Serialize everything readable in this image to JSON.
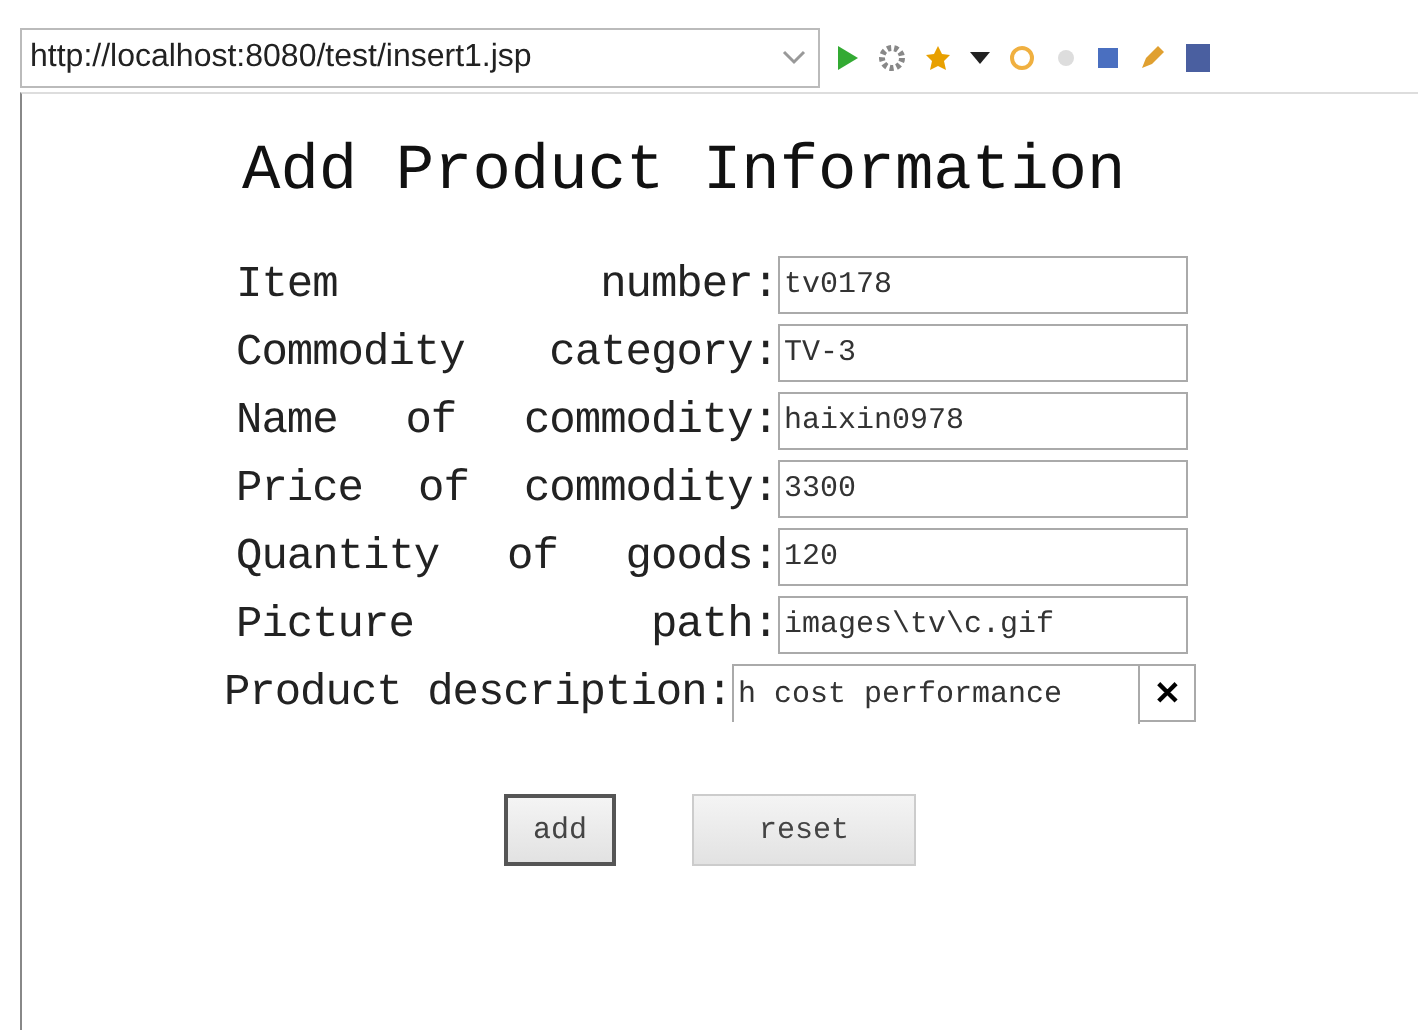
{
  "address_bar": {
    "url": "http://localhost:8080/test/insert1.jsp"
  },
  "title": "Add Product Information",
  "fields": [
    {
      "label": "Item number:",
      "value": "tv0178",
      "kind": "text"
    },
    {
      "label": "Commodity category:",
      "value": "TV-3",
      "kind": "text"
    },
    {
      "label": "Name of commodity:",
      "value": "haixin0978",
      "kind": "text"
    },
    {
      "label": "Price of commodity:",
      "value": "3300",
      "kind": "text"
    },
    {
      "label": "Quantity of goods:",
      "value": "120",
      "kind": "text"
    },
    {
      "label": "Picture path:",
      "value": "images\\tv\\c.gif",
      "kind": "text"
    },
    {
      "label": "Product description:",
      "value": "h cost performance",
      "kind": "clearable",
      "clear": "✕"
    }
  ],
  "buttons": [
    {
      "label": "add",
      "focused": true
    },
    {
      "label": "reset",
      "focused": false
    }
  ]
}
